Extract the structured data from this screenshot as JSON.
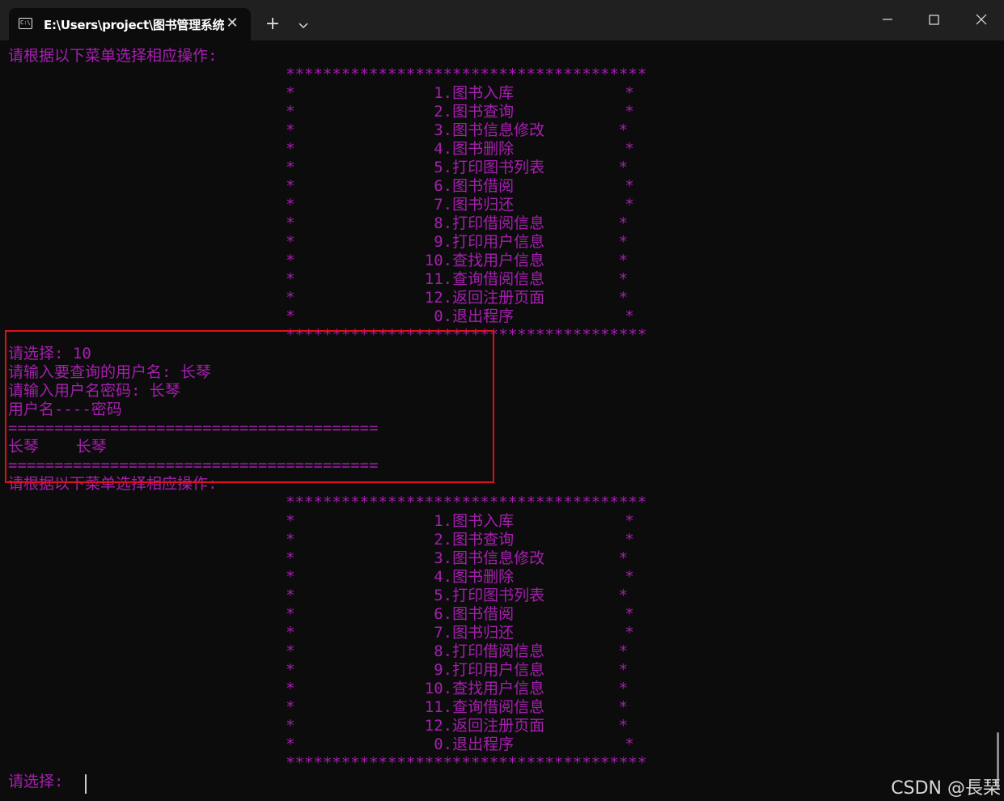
{
  "titlebar": {
    "tab_title": "E:\\Users\\project\\图书管理系统",
    "tab_icon": "C:\\",
    "close_tab_glyph": "✕",
    "new_tab_glyph": "+",
    "icons": [
      "terminal-icon",
      "close-icon",
      "plus-icon",
      "chevron-down-icon",
      "minimize-icon",
      "maximize-icon",
      "close-window-icon"
    ]
  },
  "colors": {
    "console_text": "#a61fb0",
    "background": "#0c0c0c",
    "titlebar": "#202020",
    "highlight_box": "#e0101a"
  },
  "console": {
    "lines": [
      "请根据以下菜单选择相应操作:",
      "                              ***************************************",
      "                              *               1.图书入库            *",
      "                              *               2.图书查询            *",
      "                              *               3.图书信息修改        *",
      "                              *               4.图书删除            *",
      "                              *               5.打印图书列表        *",
      "                              *               6.图书借阅            *",
      "                              *               7.图书归还            *",
      "                              *               8.打印借阅信息        *",
      "                              *               9.打印用户信息        *",
      "                              *              10.查找用户信息        *",
      "                              *              11.查询借阅信息        *",
      "                              *              12.返回注册页面        *",
      "                              *               0.退出程序            *",
      "                              ***************************************",
      "请选择: 10",
      "请输入要查询的用户名: 长琴",
      "请输入用户名密码: 长琴",
      "用户名----密码",
      "========================================",
      "长琴    长琴",
      "========================================",
      "请根据以下菜单选择相应操作:",
      "                              ***************************************",
      "                              *               1.图书入库            *",
      "                              *               2.图书查询            *",
      "                              *               3.图书信息修改        *",
      "                              *               4.图书删除            *",
      "                              *               5.打印图书列表        *",
      "                              *               6.图书借阅            *",
      "                              *               7.图书归还            *",
      "                              *               8.打印借阅信息        *",
      "                              *               9.打印用户信息        *",
      "                              *              10.查找用户信息        *",
      "                              *              11.查询借阅信息        *",
      "                              *              12.返回注册页面        *",
      "                              *               0.退出程序            *",
      "                              ***************************************",
      "请选择: "
    ]
  },
  "watermark": "CSDN @長琹"
}
